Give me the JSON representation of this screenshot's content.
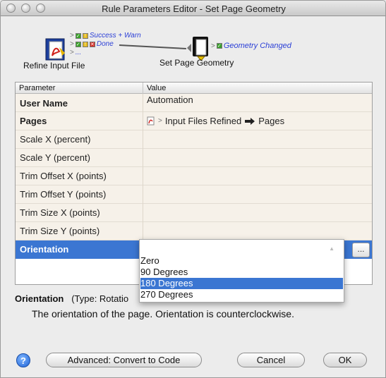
{
  "window": {
    "title": "Rule Parameters Editor - Set Page Geometry"
  },
  "flow": {
    "source": {
      "label": "Refine Input File",
      "outputs": [
        {
          "label": "Success + Warn"
        },
        {
          "label": "Done"
        },
        {
          "label": "..."
        }
      ]
    },
    "target": {
      "label": "Set Page Geometry",
      "outputs": [
        {
          "label": "Geometry Changed"
        }
      ]
    }
  },
  "table": {
    "headers": [
      "Parameter",
      "Value"
    ],
    "rows": [
      {
        "name": "User Name",
        "value": "Automation"
      },
      {
        "name": "Pages",
        "value_source": "Input Files Refined",
        "value_target": "Pages"
      },
      {
        "name": "Scale X (percent)",
        "value": ""
      },
      {
        "name": "Scale Y (percent)",
        "value": ""
      },
      {
        "name": "Trim Offset X (points)",
        "value": ""
      },
      {
        "name": "Trim Offset Y (points)",
        "value": ""
      },
      {
        "name": "Trim Size X (points)",
        "value": ""
      },
      {
        "name": "Trim Size Y (points)",
        "value": ""
      },
      {
        "name": "Orientation",
        "value": ""
      }
    ],
    "ellipsis_label": "..."
  },
  "dropdown": {
    "options": [
      "Zero",
      "90 Degrees",
      "180 Degrees",
      "270 Degrees"
    ],
    "selected": "180 Degrees"
  },
  "description": {
    "param": "Orientation",
    "type_text": "(Type: Rotatio",
    "text": "The orientation of the page. Orientation is counterclockwise."
  },
  "buttons": {
    "help": "?",
    "advanced": "Advanced: Convert to Code",
    "cancel": "Cancel",
    "ok": "OK"
  }
}
